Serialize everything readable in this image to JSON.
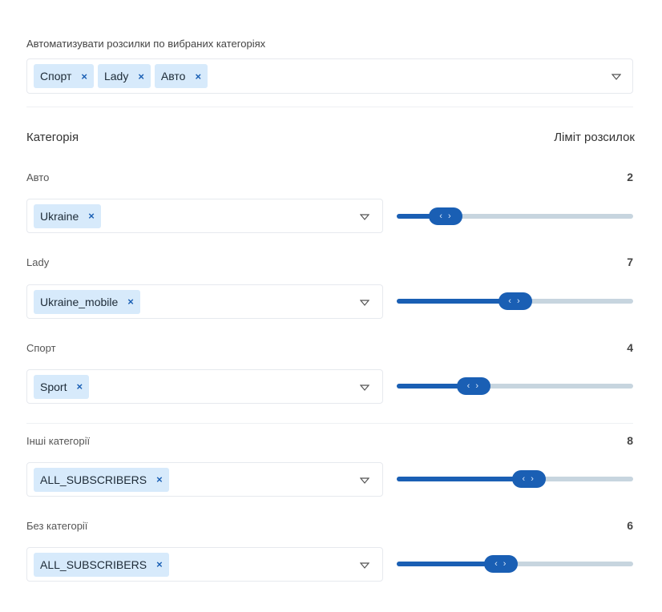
{
  "auto": {
    "label": "Автоматизувати розсилки по вибраних категоріях",
    "chips": [
      "Спорт",
      "Lady",
      "Авто"
    ]
  },
  "header": {
    "category": "Категорія",
    "limit": "Ліміт розсилок"
  },
  "chip_remove": "×",
  "slider_arrows": "‹ ›",
  "slider_max": 14,
  "rows": [
    {
      "name": "Авто",
      "limit": "2",
      "value": 2,
      "chip": "Ukraine"
    },
    {
      "name": "Lady",
      "limit": "7",
      "value": 7,
      "chip": "Ukraine_mobile"
    },
    {
      "name": "Спорт",
      "limit": "4",
      "value": 4,
      "chip": "Sport"
    },
    {
      "name": "Інші категорії",
      "limit": "8",
      "value": 8,
      "chip": "ALL_SUBSCRIBERS"
    },
    {
      "name": "Без категорії",
      "limit": "6",
      "value": 6,
      "chip": "ALL_SUBSCRIBERS"
    }
  ],
  "colors": {
    "accent": "#1a5fb4",
    "chip_bg": "#d7eafb",
    "track": "#c7d5df"
  }
}
